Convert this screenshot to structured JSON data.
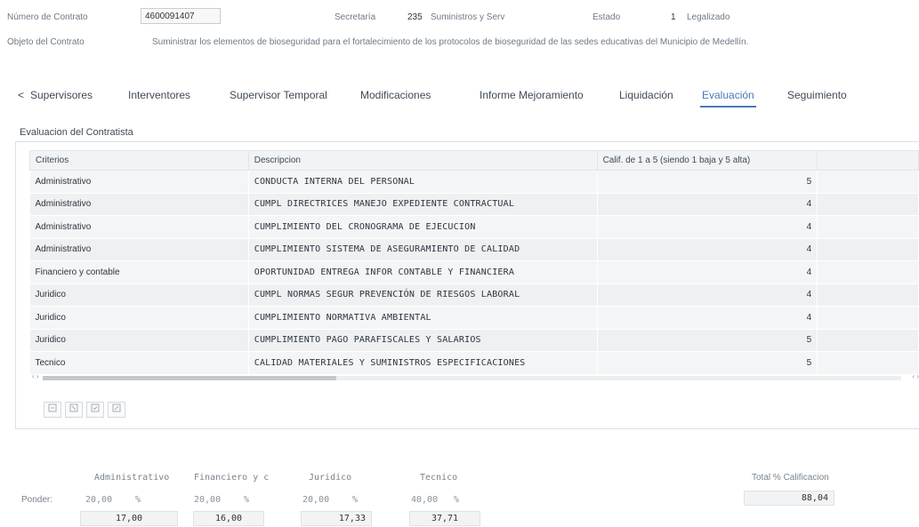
{
  "header": {
    "row1": {
      "contrato_label": "Número de Contrato",
      "contrato_value": "4600091407",
      "secretaria_label": "Secretaría",
      "secretaria_code": "235",
      "secretaria_name": "Suministros y Serv",
      "estado_label": "Estado",
      "estado_code": "1",
      "estado_name": "Legalizado"
    },
    "row2": {
      "objeto_label": "Objeto del Contrato",
      "objeto_value": "Suministrar los elementos de bioseguridad para el fortalecimiento de los protocolos de bioseguridad de las sedes educativas del Municipio de Medellín."
    }
  },
  "tabs": {
    "scroll_left": "<",
    "items": [
      "Supervisores",
      "Interventores",
      "Supervisor Temporal",
      "Modificaciones",
      "Informe Mejoramiento",
      "Liquidación",
      "Evaluación",
      "Seguimiento"
    ],
    "active": "Evaluación"
  },
  "section_title": "Evaluacion del Contratista",
  "table": {
    "columns": [
      "Criterios",
      "Descripcion",
      "Calif. de 1 a 5 (siendo 1 baja y 5 alta)"
    ],
    "rows": [
      {
        "criterio": "Administrativo",
        "descripcion": "CONDUCTA INTERNA DEL PERSONAL",
        "calif": "5"
      },
      {
        "criterio": "Administrativo",
        "descripcion": "CUMPL DIRECTRICES MANEJO EXPEDIENTE CONTRACTUAL",
        "calif": "4"
      },
      {
        "criterio": "Administrativo",
        "descripcion": "CUMPLIMIENTO DEL CRONOGRAMA DE EJECUCION",
        "calif": "4"
      },
      {
        "criterio": "Administrativo",
        "descripcion": "CUMPLIMIENTO SISTEMA DE ASEGURAMIENTO DE CALIDAD",
        "calif": "4"
      },
      {
        "criterio": "Financiero y contable",
        "descripcion": "OPORTUNIDAD ENTREGA INFOR CONTABLE Y FINANCIERA",
        "calif": "4"
      },
      {
        "criterio": "Juridico",
        "descripcion": "CUMPL NORMAS SEGUR PREVENCIÓN DE RIESGOS LABORAL",
        "calif": "4"
      },
      {
        "criterio": "Juridico",
        "descripcion": "CUMPLIMIENTO NORMATIVA AMBIENTAL",
        "calif": "4"
      },
      {
        "criterio": "Juridico",
        "descripcion": "CUMPLIMIENTO PAGO PARAFISCALES Y SALARIOS",
        "calif": "5"
      },
      {
        "criterio": "Tecnico",
        "descripcion": "CALIDAD MATERIALES Y SUMINISTROS ESPECIFICACIONES",
        "calif": "5"
      }
    ]
  },
  "scroll": {
    "left_arrows": "‹ ›",
    "right_arrows": "‹ ›"
  },
  "toolbar_icons": [
    "insert-row-icon",
    "delete-row-icon",
    "select-all-icon",
    "deselect-all-icon"
  ],
  "summary": {
    "headers": [
      "Administrativo",
      "Financiero y c",
      "Juridico",
      "Tecnico"
    ],
    "ponder_label": "Ponder:",
    "ponder": [
      {
        "value": "20,00",
        "unit": "%"
      },
      {
        "value": "20,00",
        "unit": "%"
      },
      {
        "value": "20,00",
        "unit": "%"
      },
      {
        "value": "40,00",
        "unit": "%"
      }
    ],
    "calculated": [
      "17,00",
      "16,00",
      "17,33",
      "37,71"
    ],
    "total_label": "Total % Calificacion",
    "total_value": "88,04"
  },
  "colors": {
    "accent": "#4a79b8",
    "row_bg": "#f4f5f6"
  }
}
